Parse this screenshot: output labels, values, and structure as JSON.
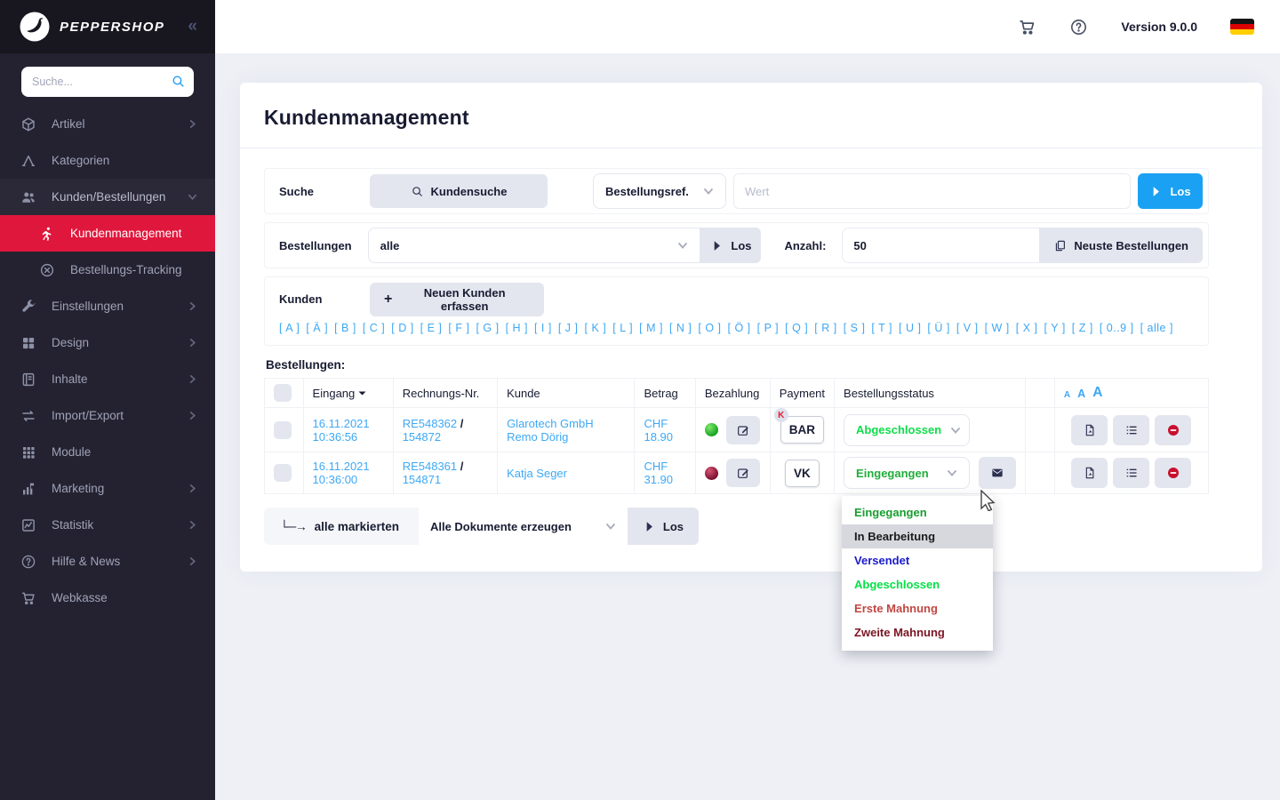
{
  "sidebar": {
    "logo_text": "PEPPERSHOP",
    "search_placeholder": "Suche...",
    "items": [
      {
        "label": "Artikel",
        "icon": "box-icon",
        "chevron": "right"
      },
      {
        "label": "Kategorien",
        "icon": "categories-icon",
        "chevron": ""
      },
      {
        "label": "Kunden/Bestellungen",
        "icon": "users-icon",
        "chevron": "down",
        "open": true
      },
      {
        "label": "Kundenmanagement",
        "icon": "running-person-icon",
        "sub": true,
        "active": true
      },
      {
        "label": "Bestellungs-Tracking",
        "icon": "tracking-icon",
        "sub": true
      },
      {
        "label": "Einstellungen",
        "icon": "wrench-icon",
        "chevron": "right"
      },
      {
        "label": "Design",
        "icon": "design-grid-icon",
        "chevron": "right"
      },
      {
        "label": "Inhalte",
        "icon": "content-icon",
        "chevron": "right"
      },
      {
        "label": "Import/Export",
        "icon": "import-export-icon",
        "chevron": "right"
      },
      {
        "label": "Module",
        "icon": "modules-icon",
        "chevron": ""
      },
      {
        "label": "Marketing",
        "icon": "marketing-icon",
        "chevron": "right"
      },
      {
        "label": "Statistik",
        "icon": "statistics-icon",
        "chevron": "right"
      },
      {
        "label": "Hilfe & News",
        "icon": "help-icon",
        "chevron": "right"
      },
      {
        "label": "Webkasse",
        "icon": "cart-icon",
        "chevron": ""
      }
    ]
  },
  "topbar": {
    "version": "Version 9.0.0"
  },
  "page": {
    "title": "Kundenmanagement"
  },
  "filters": {
    "search_label": "Suche",
    "customer_search_button": "Kundensuche",
    "ref_select": "Bestellungsref.",
    "value_placeholder": "Wert",
    "go_label": "Los",
    "orders_label": "Bestellungen",
    "orders_select": "alle",
    "count_label": "Anzahl:",
    "count_value": "50",
    "newest_orders_button": "Neuste Bestellungen",
    "customers_label": "Kunden",
    "new_customer_button": "Neuen Kunden erfassen",
    "alphabet": [
      "A",
      "Ä",
      "B",
      "C",
      "D",
      "E",
      "F",
      "G",
      "H",
      "I",
      "J",
      "K",
      "L",
      "M",
      "N",
      "O",
      "Ö",
      "P",
      "Q",
      "R",
      "S",
      "T",
      "U",
      "Ü",
      "V",
      "W",
      "X",
      "Y",
      "Z",
      "0..9",
      "alle"
    ]
  },
  "orders": {
    "section_label": "Bestellungen:",
    "columns": [
      "Eingang",
      "Rechnungs-Nr.",
      "Kunde",
      "Betrag",
      "Bezahlung",
      "Payment",
      "Bestellungsstatus"
    ],
    "font_sizes": [
      "A",
      "A",
      "A"
    ],
    "rows": [
      {
        "date": "16.11.2021 10:36:56",
        "invoice": "RE548362",
        "order_no": "154872",
        "customer": "Glarotech GmbH Remo Dörig",
        "amount": "CHF 18.90",
        "paid_color": "green",
        "payment": "BAR",
        "payment_badge": "K",
        "status": "Abgeschlossen",
        "status_color": "#0ddd49",
        "has_mail": false,
        "dropdown_open": false
      },
      {
        "date": "16.11.2021 10:36:00",
        "invoice": "RE548361",
        "order_no": "154871",
        "customer": "Katja Seger",
        "amount": "CHF 31.90",
        "paid_color": "darkred",
        "payment": "VK",
        "payment_badge": "",
        "status": "Eingegangen",
        "status_color": "#1fae3a",
        "has_mail": true,
        "dropdown_open": true
      }
    ],
    "status_options": [
      {
        "label": "Eingegangen",
        "color": "#169f2e",
        "highlighted": false
      },
      {
        "label": "In Bearbeitung",
        "color": "#1b1b1b",
        "highlighted": true
      },
      {
        "label": "Versendet",
        "color": "#1a1acb",
        "highlighted": false
      },
      {
        "label": "Abgeschlossen",
        "color": "#05e045",
        "highlighted": false
      },
      {
        "label": "Erste Mahnung",
        "color": "#c14742",
        "highlighted": false
      },
      {
        "label": "Zweite Mahnung",
        "color": "#7b1623",
        "highlighted": false
      }
    ],
    "bulk": {
      "marked_label": "alle markierten",
      "action_select": "Alle Dokumente erzeugen",
      "go_label": "Los"
    }
  },
  "colors": {
    "accent_red": "#e0173c",
    "link_blue": "#3da9f5",
    "primary_blue": "#1aa1f3",
    "sidebar_bg": "#242231",
    "flag": [
      "#141414",
      "#dd0000",
      "#ffce00"
    ]
  }
}
